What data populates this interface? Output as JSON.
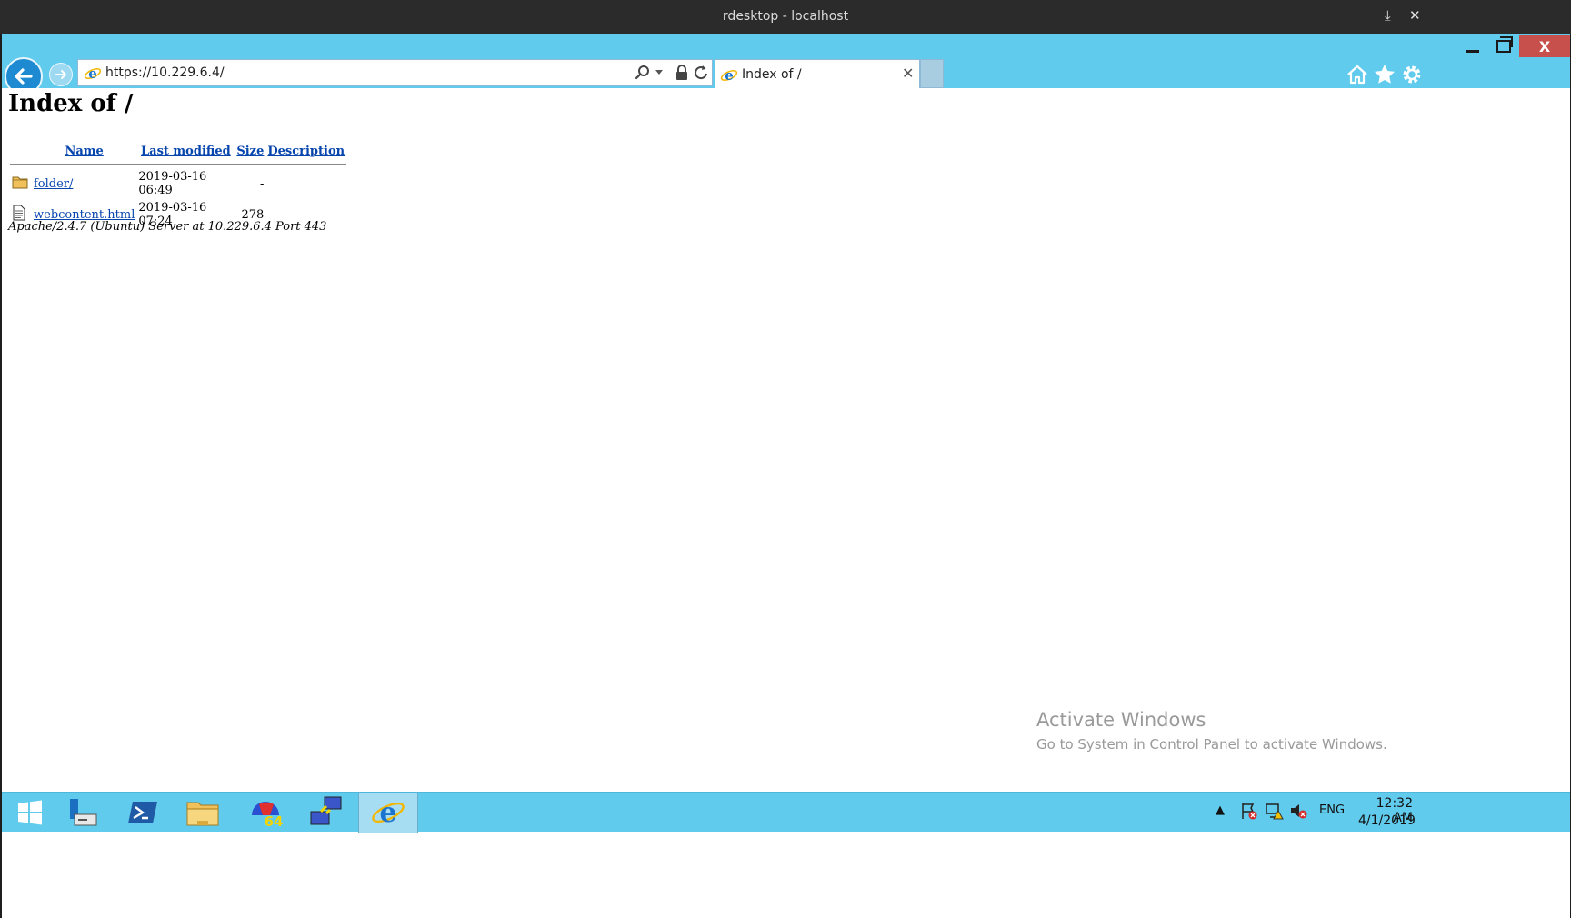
{
  "rdesktop": {
    "title": "rdesktop - localhost",
    "download_icon": "⤓",
    "close_icon": "✕"
  },
  "browser": {
    "address": "https://10.229.6.4/",
    "tab_title": "Index of /",
    "close_glyph": "X",
    "tab_close_glyph": "✕"
  },
  "page": {
    "heading": "Index of /",
    "columns": {
      "name": "Name",
      "last_modified": "Last modified",
      "size": "Size",
      "description": "Description"
    },
    "rows": [
      {
        "icon": "folder-icon",
        "name": "folder/",
        "modified": "2019-03-16 06:49",
        "size": "-",
        "description": ""
      },
      {
        "icon": "file-icon",
        "name": "webcontent.html",
        "modified": "2019-03-16 07:24",
        "size": "278",
        "description": ""
      }
    ],
    "footer": "Apache/2.4.7 (Ubuntu) Server at 10.229.6.4 Port 443"
  },
  "watermark": {
    "title": "Activate Windows",
    "subtitle": "Go to System in Control Panel to activate Windows."
  },
  "taskbar": {
    "items": [
      "start-button",
      "server-manager",
      "powershell",
      "file-explorer",
      "aida64",
      "network-tool",
      "internet-explorer"
    ],
    "aida_label": "64",
    "language": "ENG",
    "time": "12:32 AM",
    "date": "4/1/2019",
    "tray_expand": "▲"
  },
  "colors": {
    "chrome": "#61cbed",
    "close": "#c7504d",
    "link": "#0645ad"
  }
}
